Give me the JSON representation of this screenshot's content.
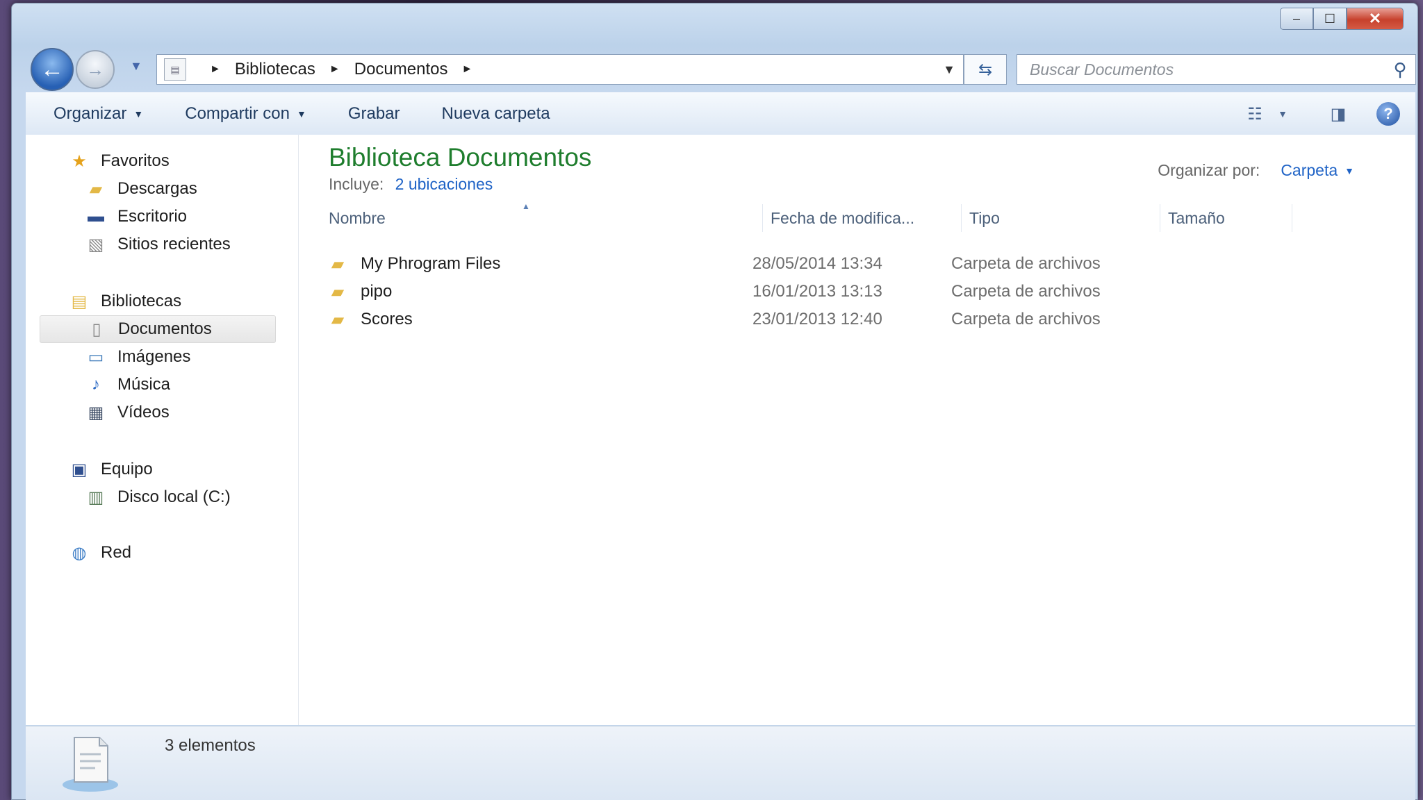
{
  "window": {
    "caption": {
      "minimize": "–",
      "maximize": "☐",
      "close": "✕"
    }
  },
  "nav": {
    "back_glyph": "←",
    "forward_glyph": "→",
    "history_glyph": "▼",
    "breadcrumb": [
      "Bibliotecas",
      "Documentos"
    ],
    "separator_glyph": "►",
    "dropdown_glyph": "▼",
    "refresh_glyph": "⇆",
    "search_placeholder": "Buscar Documentos",
    "search_icon": "search-icon"
  },
  "toolbar": {
    "organize": "Organizar",
    "share": "Compartir con",
    "burn": "Grabar",
    "new_folder": "Nueva carpeta",
    "caret": "▼",
    "help_glyph": "?"
  },
  "sidebar": {
    "favorites": {
      "label": "Favoritos",
      "items": [
        {
          "label": "Descargas",
          "icon": "downloads-folder-icon"
        },
        {
          "label": "Escritorio",
          "icon": "desktop-icon"
        },
        {
          "label": "Sitios recientes",
          "icon": "recent-places-icon"
        }
      ]
    },
    "libraries": {
      "label": "Bibliotecas",
      "items": [
        {
          "label": "Documentos",
          "icon": "documents-icon",
          "selected": true
        },
        {
          "label": "Imágenes",
          "icon": "pictures-icon"
        },
        {
          "label": "Música",
          "icon": "music-icon"
        },
        {
          "label": "Vídeos",
          "icon": "videos-icon"
        }
      ]
    },
    "computer": {
      "label": "Equipo",
      "items": [
        {
          "label": "Disco local (C:)",
          "icon": "local-disk-icon"
        }
      ]
    },
    "network": {
      "label": "Red"
    }
  },
  "content": {
    "title": "Biblioteca Documentos",
    "includes_label": "Incluye:",
    "includes_link": "2 ubicaciones",
    "arrange_label": "Organizar por:",
    "arrange_value": "Carpeta",
    "columns": [
      "Nombre",
      "Fecha de modifica...",
      "Tipo",
      "Tamaño"
    ],
    "rows": [
      {
        "name": "My Phrogram Files",
        "date": "28/05/2014 13:34",
        "type": "Carpeta de archivos",
        "size": ""
      },
      {
        "name": "pipo",
        "date": "16/01/2013 13:13",
        "type": "Carpeta de archivos",
        "size": ""
      },
      {
        "name": "Scores",
        "date": "23/01/2013 12:40",
        "type": "Carpeta de archivos",
        "size": ""
      }
    ]
  },
  "details": {
    "count": "3 elementos"
  },
  "colors": {
    "title_green": "#1e7d2d",
    "link_blue": "#1f63c6",
    "folder_yellow": "#e3b846"
  }
}
